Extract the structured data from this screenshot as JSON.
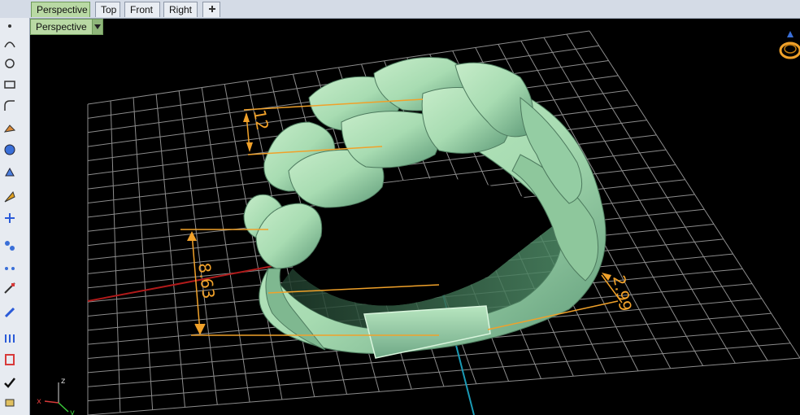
{
  "tabs": [
    {
      "label": "Perspective"
    },
    {
      "label": "Top"
    },
    {
      "label": "Front"
    },
    {
      "label": "Right"
    }
  ],
  "add_tab_icon": "plus-icon",
  "viewport": {
    "label": "Perspective"
  },
  "dimensions": {
    "height_label": "8.63",
    "top_width_label": "12",
    "band_width_label": "2.99"
  },
  "axis_indicator": {
    "z_label": "z",
    "y_label": "y",
    "x_label": "x"
  },
  "colors": {
    "ring_fill": "#a8dcb2",
    "ring_shadow": "#6fa886",
    "grid": "#8c8c8c",
    "x_axis": "#b01a1a",
    "y_axis": "#1a9ab5",
    "dimension": "#f0a12a",
    "active_tab": "#b9d9a4",
    "gizmo": "#f0a12a"
  },
  "toolbar_icons": [
    "point-icon",
    "curve-icon",
    "circle-icon",
    "rectangle-icon",
    "arc-icon",
    "surface-icon",
    "sphere-icon",
    "extrude-icon",
    "mesh-icon",
    "light-icon",
    "transform-icon",
    "array-icon",
    "analyze-icon",
    "dimension-icon",
    "grid-icon",
    "render-icon",
    "check-icon",
    "osnap-icon"
  ],
  "view_gizmo_icon": "ring-view-icon"
}
